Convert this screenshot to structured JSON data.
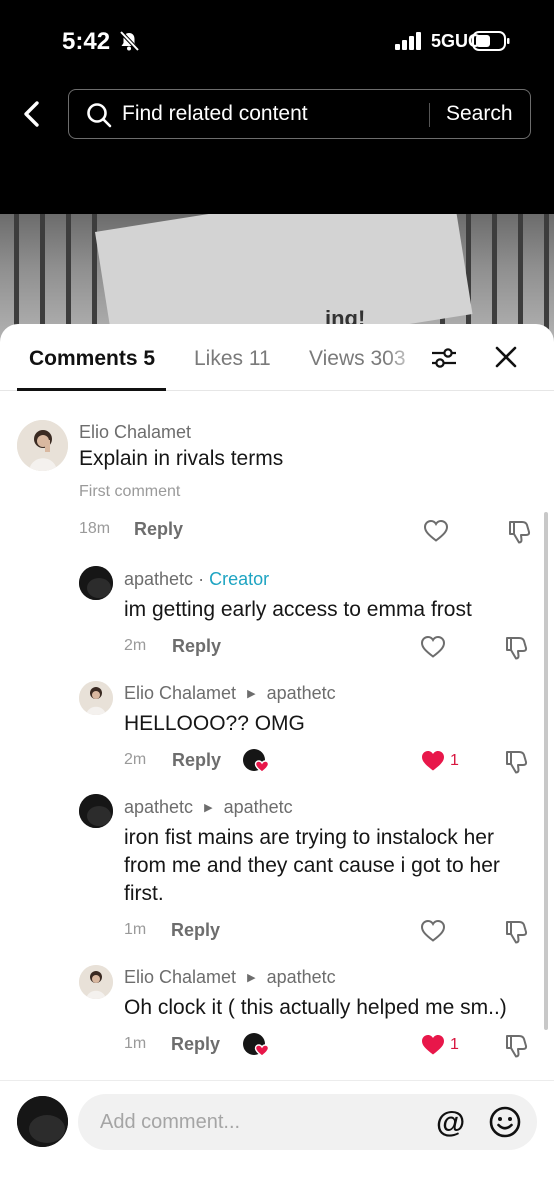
{
  "status_bar": {
    "time": "5:42",
    "network": "5GUC"
  },
  "search": {
    "placeholder": "Find related content",
    "button": "Search"
  },
  "video": {
    "overlay_text": "ing!"
  },
  "tabs": [
    {
      "label": "Comments 5"
    },
    {
      "label": "Likes 11"
    },
    {
      "label": "Views 303"
    }
  ],
  "comments": [
    {
      "user": "Elio Chalamet",
      "text": "Explain in rivals terms",
      "note": "First comment",
      "time": "18m",
      "reply": "Reply"
    },
    {
      "user": "apathetc",
      "tag": "Creator",
      "text": "im getting early access to emma frost",
      "time": "2m",
      "reply": "Reply"
    },
    {
      "user": "Elio Chalamet",
      "reply_to": "apathetc",
      "text": "HELLOOO?? OMG",
      "time": "2m",
      "reply": "Reply",
      "likes": "1"
    },
    {
      "user": "apathetc",
      "reply_to": "apathetc",
      "text": "iron fist mains are trying to instalock her from me and they cant cause i got to her first.",
      "time": "1m",
      "reply": "Reply"
    },
    {
      "user": "Elio Chalamet",
      "reply_to": "apathetc",
      "text": "Oh clock it ( this actually helped me sm..)",
      "time": "1m",
      "reply": "Reply",
      "likes": "1"
    }
  ],
  "input": {
    "placeholder": "Add comment...",
    "at": "@"
  },
  "colors": {
    "accent_like": "#e8174a",
    "creator": "#1ea4c2"
  }
}
